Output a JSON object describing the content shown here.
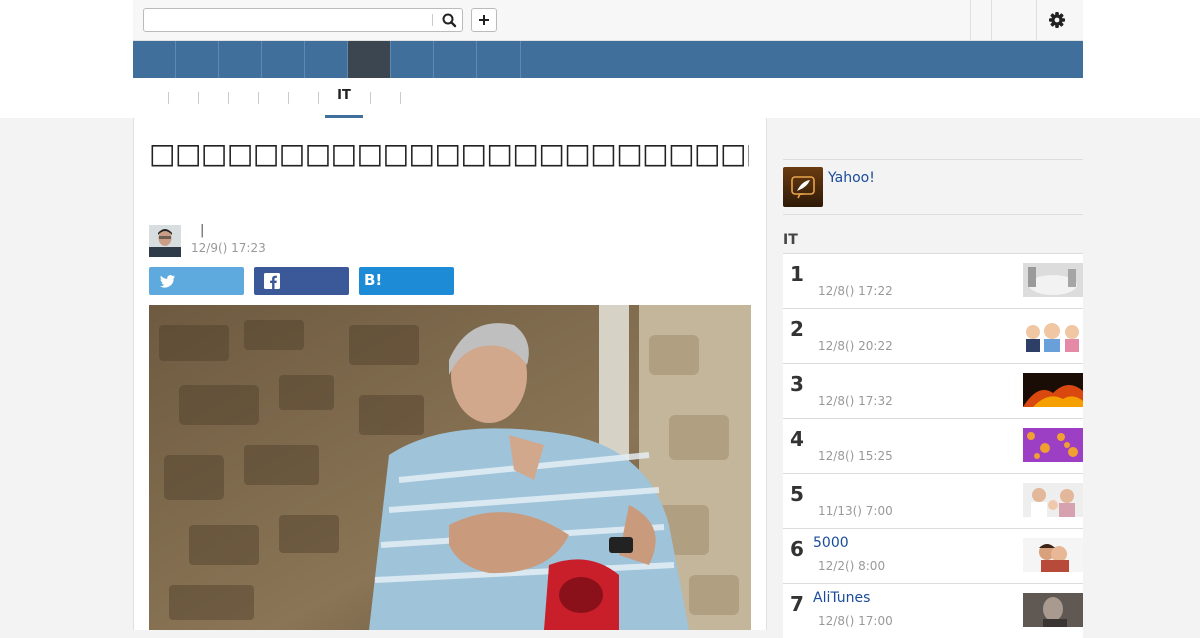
{
  "search": {
    "value": "",
    "placeholder": ""
  },
  "header": {
    "search_icon": "search-icon",
    "add_icon": "plus-icon",
    "settings_icon": "gear-icon"
  },
  "subnav": {
    "active_tab": "IT"
  },
  "article": {
    "title": "□□□□□□□□□□□□□□□□□□□□□□□□□□□□□□□□□□□",
    "author_separator": "|",
    "date": "12/9() 17:23"
  },
  "share": {
    "twitter_icon": "twitter-icon",
    "facebook_icon": "facebook-icon",
    "hatena_label": "B!"
  },
  "sidebar": {
    "promo_link": "Yahoo!",
    "ranking_title": "IT",
    "ranking": [
      {
        "rank": "1",
        "title": "",
        "date": "12/8() 17:22",
        "thumb_color": "#b7b7b7"
      },
      {
        "rank": "2",
        "title": "",
        "date": "12/8() 20:22",
        "thumb_color": "#e7c9b3"
      },
      {
        "rank": "3",
        "title": "",
        "date": "12/8() 17:32",
        "thumb_color": "#c2410c"
      },
      {
        "rank": "4",
        "title": "",
        "date": "12/8() 15:25",
        "thumb_color": "#a148c7"
      },
      {
        "rank": "5",
        "title": "",
        "date": "11/13() 7:00",
        "thumb_color": "#d9c3b6"
      },
      {
        "rank": "6",
        "title": "5000",
        "date": "12/2() 8:00",
        "thumb_color": "#c89a7a"
      },
      {
        "rank": "7",
        "title": "AliTunes",
        "date": "12/8() 17:00",
        "thumb_color": "#6d6560"
      }
    ]
  }
}
